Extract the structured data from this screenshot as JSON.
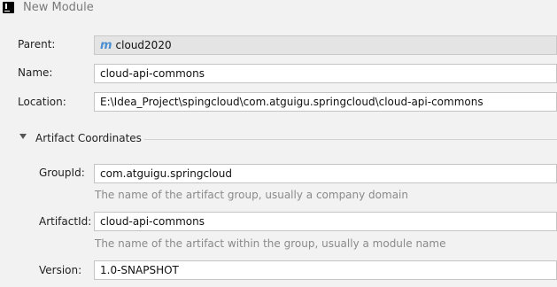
{
  "window": {
    "title": "New Module",
    "app_icon": "intellij-icon"
  },
  "form": {
    "parent": {
      "label": "Parent:",
      "value": "cloud2020",
      "icon": "m"
    },
    "name": {
      "label": "Name:",
      "value": "cloud-api-commons"
    },
    "location": {
      "label": "Location:",
      "value": "E:\\Idea_Project\\spingcloud\\com.atguigu.springcloud\\cloud-api-commons"
    }
  },
  "artifact": {
    "section_label": "Artifact Coordinates",
    "groupid": {
      "label": "GroupId:",
      "value": "com.atguigu.springcloud",
      "hint": "The name of the artifact group, usually a company domain"
    },
    "artifactid": {
      "label": "ArtifactId:",
      "value": "cloud-api-commons",
      "hint": "The name of the artifact within the group, usually a module name"
    },
    "version": {
      "label": "Version:",
      "value": "1.0-SNAPSHOT"
    }
  }
}
